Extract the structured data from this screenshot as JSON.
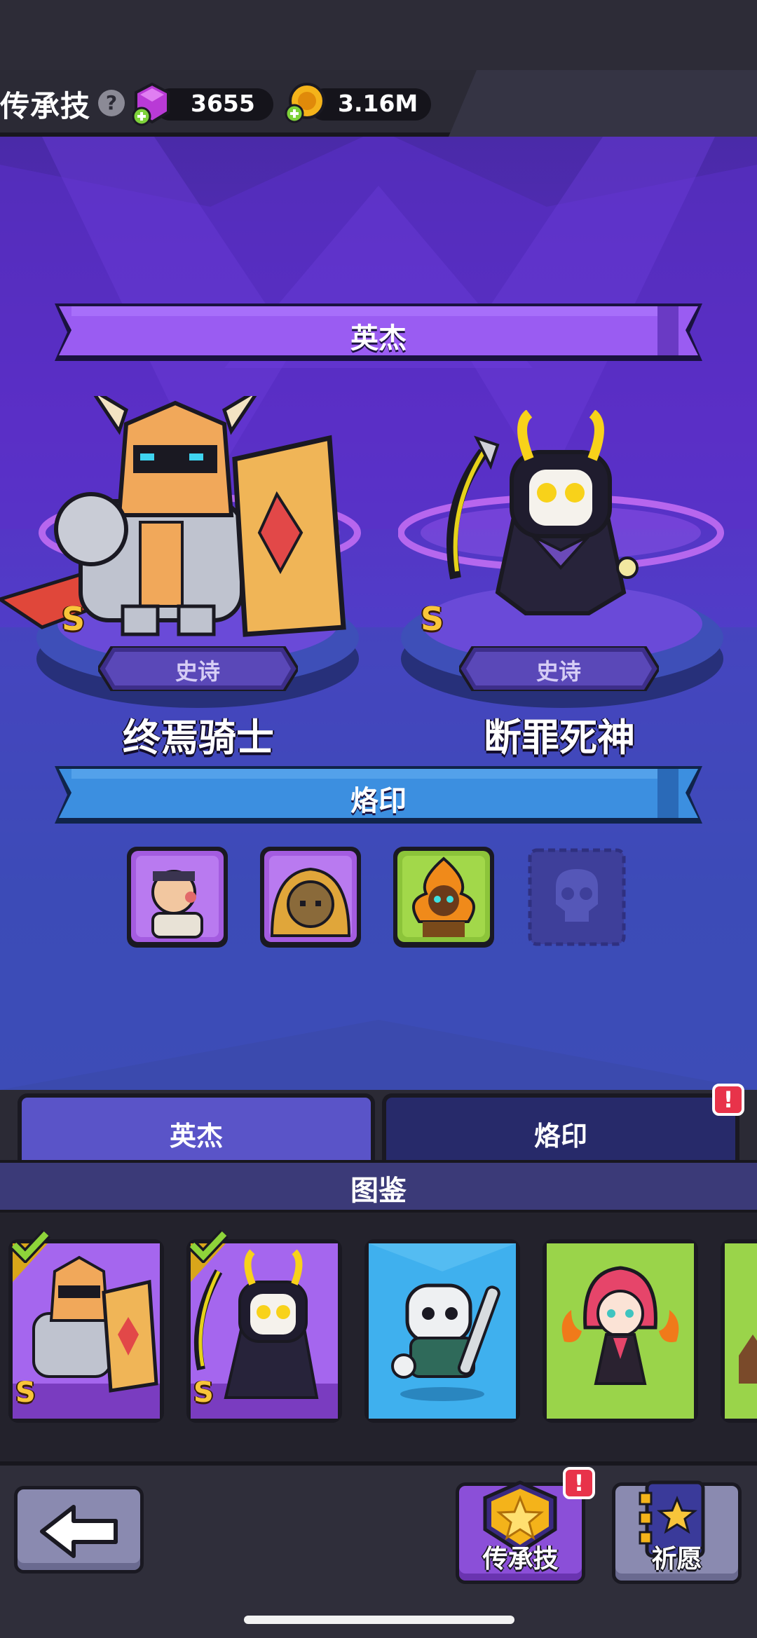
{
  "header": {
    "title": "传承技",
    "help_icon": "?",
    "gems": "3655",
    "coins": "3.16M"
  },
  "heroes_section": {
    "title": "英杰",
    "heroes": [
      {
        "name": "终焉骑士",
        "rarity": "史诗",
        "grade": "S",
        "icon": "knight-hero-icon"
      },
      {
        "name": "断罪死神",
        "rarity": "史诗",
        "grade": "S",
        "icon": "reaper-hero-icon"
      }
    ]
  },
  "emblem_section": {
    "title": "烙印",
    "slots": [
      {
        "icon": "bandit-portrait-icon",
        "locked": false
      },
      {
        "icon": "hooded-monkey-portrait-icon",
        "locked": false
      },
      {
        "icon": "flame-spirit-portrait-icon",
        "locked": false
      },
      {
        "icon": "skull-icon",
        "locked": true
      }
    ]
  },
  "tabs": [
    {
      "label": "英杰",
      "active": true
    },
    {
      "label": "烙印",
      "active": false,
      "badge": "!"
    }
  ],
  "collection": {
    "title": "图鉴",
    "cards": [
      {
        "icon": "knight-card-icon",
        "grade": "S",
        "owned": true,
        "color": "#8b4fd8"
      },
      {
        "icon": "reaper-card-icon",
        "grade": "S",
        "owned": true,
        "color": "#8b4fd8"
      },
      {
        "icon": "skeleton-card-icon",
        "grade": "",
        "owned": false,
        "color": "#2f9ad8"
      },
      {
        "icon": "red-witch-card-icon",
        "grade": "",
        "owned": false,
        "color": "#8cc43a"
      },
      {
        "icon": "partial-card-icon",
        "grade": "",
        "owned": false,
        "color": "#8cc43a"
      }
    ]
  },
  "bottom_bar": {
    "legacy_label": "传承技",
    "legacy_badge": "!",
    "wish_label": "祈愿"
  },
  "colors": {
    "hero_banner": "#9a5cf2",
    "emblem_banner": "#3c8fe0",
    "grade_gold": "#f8c53a",
    "badge_red": "#e8334a"
  }
}
